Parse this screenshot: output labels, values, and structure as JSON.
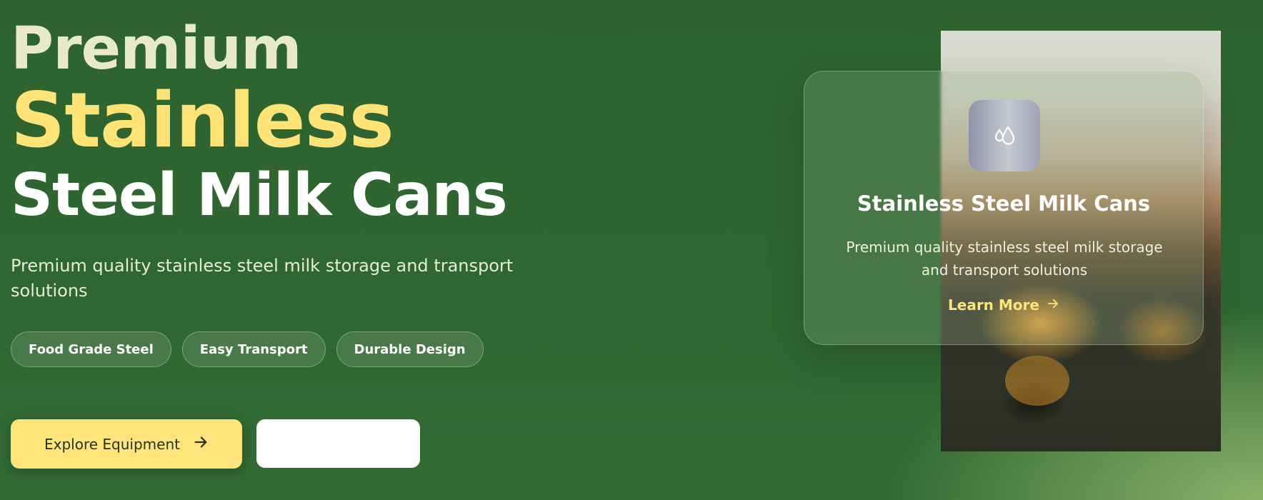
{
  "hero": {
    "title_line1": "Premium",
    "title_line2": "Stainless",
    "title_line3": "Steel Milk Cans",
    "subtitle": "Premium quality stainless steel milk storage and transport solutions",
    "tags": [
      "Food Grade Steel",
      "Easy Transport",
      "Durable Design"
    ],
    "primary_button_label": "Explore Equipment",
    "primary_button_icon": "arrow-right-icon",
    "secondary_button_label": ""
  },
  "card": {
    "icon": "droplets-icon",
    "title": "Stainless Steel Milk Cans",
    "description": "Premium quality stainless steel milk storage and transport solutions",
    "link_label": "Learn More",
    "link_icon": "arrow-right-icon"
  },
  "colors": {
    "background": "#2f6631",
    "accent_yellow": "#ffe37b",
    "title_cream": "#e7e9c9"
  }
}
